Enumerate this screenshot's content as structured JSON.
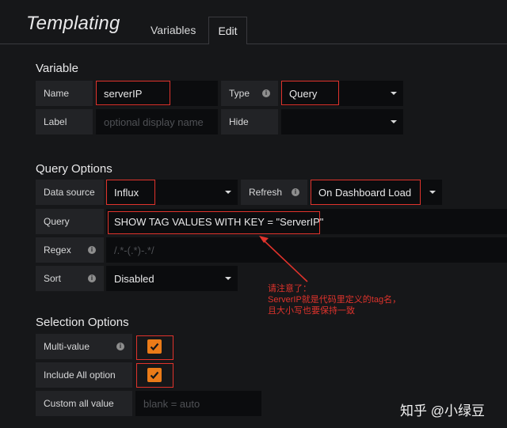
{
  "header": {
    "title": "Templating",
    "tabs": [
      "Variables",
      "Edit"
    ]
  },
  "variable": {
    "section_title": "Variable",
    "name_label": "Name",
    "name_value": "serverIP",
    "type_label": "Type",
    "type_value": "Query",
    "label_label": "Label",
    "label_placeholder": "optional display name",
    "hide_label": "Hide",
    "hide_value": ""
  },
  "query_options": {
    "section_title": "Query Options",
    "datasource_label": "Data source",
    "datasource_value": "Influx",
    "refresh_label": "Refresh",
    "refresh_value": "On Dashboard Load",
    "query_label": "Query",
    "query_value": "SHOW TAG VALUES WITH KEY = \"ServerIP\"",
    "regex_label": "Regex",
    "regex_placeholder": "/.*-(.*)-.*/",
    "sort_label": "Sort",
    "sort_value": "Disabled"
  },
  "selection_options": {
    "section_title": "Selection Options",
    "multi_value_label": "Multi-value",
    "multi_value_checked": true,
    "include_all_label": "Include All option",
    "include_all_checked": true,
    "custom_all_label": "Custom all value",
    "custom_all_placeholder": "blank = auto"
  },
  "annotation": {
    "line1": "请注意了：",
    "line2": "ServerIP就是代码里定义的tag名，",
    "line3": "且大小写也要保持一致"
  },
  "watermark": "知乎 @小绿豆",
  "colors": {
    "background": "#161719",
    "label_bg": "#222326",
    "input_bg": "#0b0c0e",
    "checkbox": "#eb7b18",
    "highlight_red": "#e0332c"
  },
  "icons": {
    "info": "info-circle-icon",
    "caret": "caret-down-icon",
    "check": "checkmark-icon",
    "arrow": "red-arrow"
  }
}
